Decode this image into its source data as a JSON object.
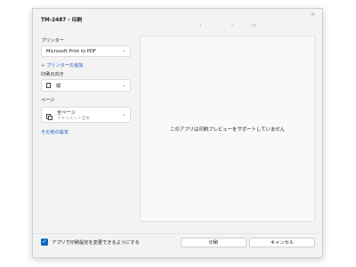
{
  "dialog": {
    "title": "TM-2487 - 印刷",
    "close_glyph": "×"
  },
  "printer": {
    "label": "プリンター",
    "selected": "Microsoft Print to PDF",
    "add_link": "+ プリンターの追加"
  },
  "orientation": {
    "label": "印刷の向き",
    "selected": "縦"
  },
  "pages": {
    "label": "ページ",
    "selected": "全ページ",
    "subtext": "ドキュメント全体"
  },
  "more_settings_link": "その他の設定",
  "preview": {
    "message": "このアプリは印刷プレビューをサポートしていません",
    "nav_prev": "‹",
    "nav_next": "›",
    "nav_fit": "▭"
  },
  "footer": {
    "checkbox_label": "アプリで印刷設定を変更できるようにする",
    "checkbox_checked": true,
    "print_button": "印刷",
    "cancel_button": "キャンセル"
  },
  "icons": {
    "chevron": "⌄",
    "checkmark": "✓"
  },
  "colors": {
    "accent": "#0f6cbd",
    "link": "#1f5fbf"
  }
}
